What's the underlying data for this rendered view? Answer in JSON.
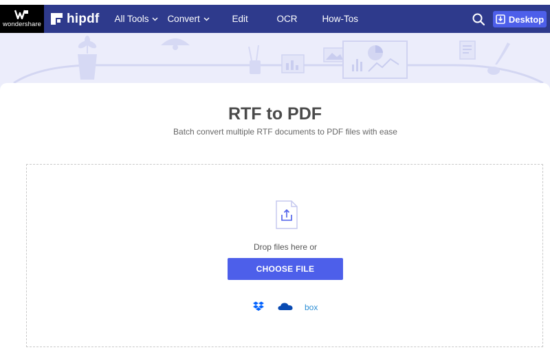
{
  "colors": {
    "nav_bg": "#2e3a8c",
    "accent": "#4d5fea",
    "hero_bg": "#ecedfb",
    "dropbox": "#0061fe",
    "onedrive": "#094ab2",
    "box": "#2d8fd5"
  },
  "header": {
    "wondershare_label": "wondershare",
    "brand": "hipdf",
    "nav": [
      {
        "label": "All Tools",
        "has_dropdown": true
      },
      {
        "label": "Convert",
        "has_dropdown": true
      },
      {
        "label": "Edit",
        "has_dropdown": false
      },
      {
        "label": "OCR",
        "has_dropdown": false
      },
      {
        "label": "How-Tos",
        "has_dropdown": false
      }
    ],
    "search_icon": "search-icon",
    "desktop_label": "Desktop",
    "desktop_icon": "download-icon"
  },
  "main": {
    "title": "RTF to PDF",
    "subtitle": "Batch convert multiple RTF documents to PDF files with ease"
  },
  "upload": {
    "file_icon": "upload-file-icon",
    "drop_text": "Drop files here or",
    "choose_label": "CHOOSE FILE",
    "sources": [
      {
        "name": "Dropbox",
        "icon": "dropbox-icon"
      },
      {
        "name": "OneDrive",
        "icon": "onedrive-icon"
      },
      {
        "name": "Box",
        "label": "box"
      }
    ]
  }
}
